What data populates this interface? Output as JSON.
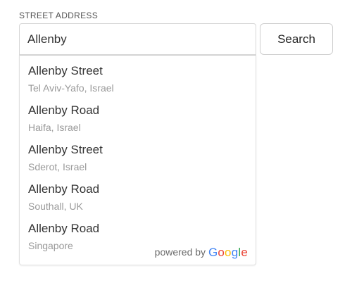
{
  "form": {
    "label": "STREET ADDRESS",
    "input_value": "Allenby",
    "button_label": "Search"
  },
  "suggestions": [
    {
      "primary": "Allenby Street",
      "secondary": "Tel Aviv-Yafo, Israel"
    },
    {
      "primary": "Allenby Road",
      "secondary": "Haifa, Israel"
    },
    {
      "primary": "Allenby Street",
      "secondary": "Sderot, Israel"
    },
    {
      "primary": "Allenby Road",
      "secondary": "Southall, UK"
    },
    {
      "primary": "Allenby Road",
      "secondary": "Singapore"
    }
  ],
  "attribution": {
    "prefix": "powered by",
    "brand": "Google",
    "brand_colors": [
      "#4285F4",
      "#EA4335",
      "#FBBC05",
      "#4285F4",
      "#34A853",
      "#EA4335"
    ]
  }
}
